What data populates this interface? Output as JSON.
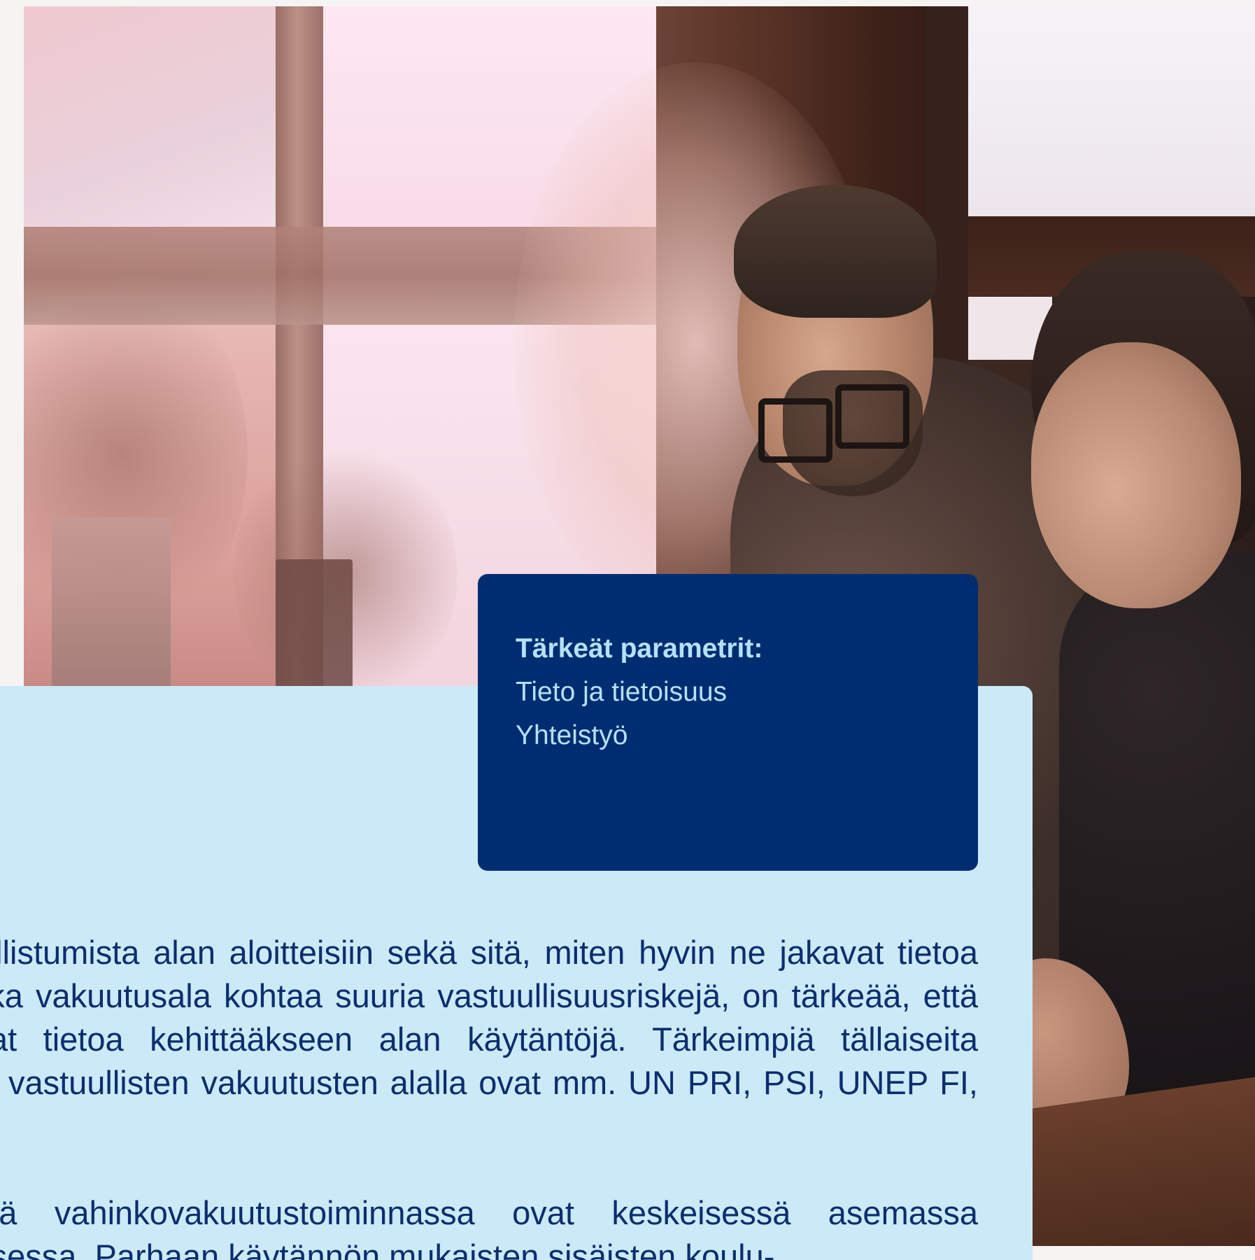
{
  "hero_image": {
    "description_icon": "photo-two-people-at-window"
  },
  "parameters_card": {
    "title": "Tärkeät parametrit:",
    "items": [
      "Tieto ja tietoisuus",
      "Yhteistyö"
    ]
  },
  "body": {
    "paragraph_1": "Parametrissa tarkastellaan yritysten osallistumista alan aloitteisiin sekä sitä, miten hyvin ne jakavat tietoa kestävyydestä ja vastuullisuudesta. Koska vakuutusala kohtaa suuria vastuullisuusriskejä, on tärkeää, että yritykset tekevät yhteistyötä ja jakavat tietoa kehittääkseen alan käytäntöjä. Tärkeimpiä tällaiseita yhteistyöaloitteita kestävien sijoitusten ja vastuullisten vakuutusten alalla ovat mm. UN PRI, PSI, UNEP FI, Finsif, Swesif ja Climate Wise.",
    "paragraph_2": "Vastuulliseen liiketoimintaan liittyvässä vahinkovakuutustoiminnassa ovat keskeisessä asemassa ohjeistukset ja niiden käytännön toteutuksessa. Parhaan käytännön mukaisten sisäisten koulu-"
  },
  "colors": {
    "panel_light_blue": "#cbe9f7",
    "card_navy": "#002d72",
    "card_text": "#b6e0f6",
    "body_text": "#0c2e6e"
  }
}
